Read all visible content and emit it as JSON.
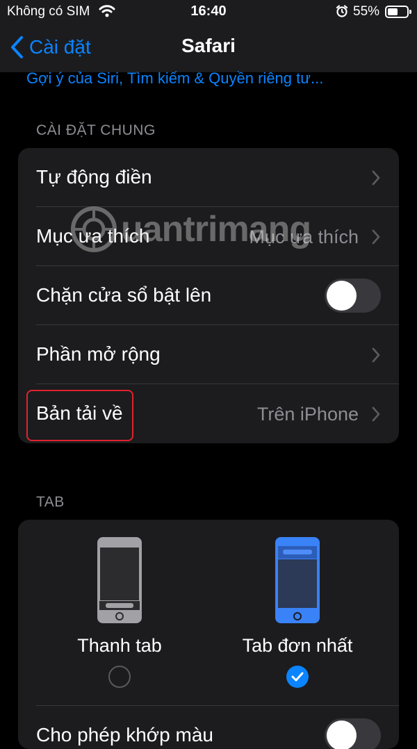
{
  "status_bar": {
    "carrier": "Không có SIM",
    "time": "16:40",
    "battery": "55%"
  },
  "nav": {
    "back_label": "Cài đặt",
    "title": "Safari"
  },
  "siri_link": "Gợi ý của Siri, Tìm kiếm & Quyền riêng tư...",
  "general": {
    "header": "CÀI ĐẶT CHUNG",
    "autofill": "Tự động điền",
    "favorites_label": "Mục ưa thích",
    "favorites_value": "Mục ưa thích",
    "block_popups": "Chặn cửa sổ bật lên",
    "block_popups_on": false,
    "extensions": "Phần mở rộng",
    "downloads_label": "Bản tải về",
    "downloads_value": "Trên iPhone"
  },
  "tabs": {
    "header": "TAB",
    "tab_bar": "Thanh tab",
    "single_tab": "Tab đơn nhất",
    "selected": "single_tab",
    "color_match": "Cho phép khớp màu"
  },
  "watermark": "uantrimang",
  "colors": {
    "accent": "#0a84ff",
    "highlight": "#e0232e",
    "cell": "#1c1c1e"
  }
}
